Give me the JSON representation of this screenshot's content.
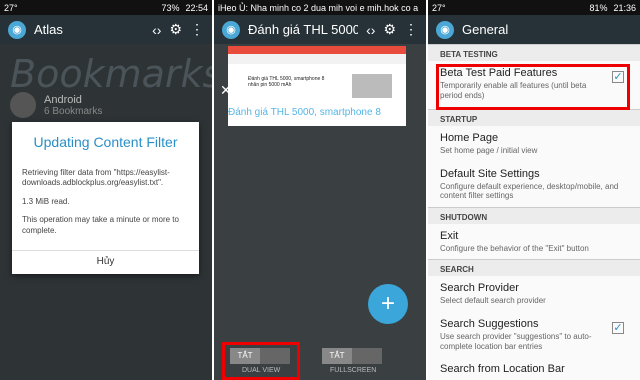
{
  "panel1": {
    "status": {
      "left": "27°",
      "right": "73%",
      "time": "22:54"
    },
    "app_title": "Atlas",
    "bookmarks_heading": "Bookmarks",
    "folder": {
      "name": "Android",
      "count": "6 Bookmarks"
    },
    "dialog": {
      "title": "Updating Content Filter",
      "line1": "Retrieving filter data from \"https://easylist-downloads.adblockplus.org/easylist.txt\".",
      "line2": "1.3 MiB read.",
      "line3": "This operation may take a minute or more to complete.",
      "button": "Hủy"
    }
  },
  "panel2": {
    "status": {
      "notification": "iHeo Ủ: Nha minh co 2 dua mih voi e mih.hok co a"
    },
    "tab_title": "Đánh giá THL 5000",
    "thumb_headline": "Đánh giá THL 5000, smartphone 8 nhân pin 5000 mAh",
    "tab_label": "Đánh giá THL 5000, smartphone 8",
    "fab": "+",
    "toggles": [
      {
        "state": "TẮT",
        "label": "DUAL VIEW"
      },
      {
        "state": "TẮT",
        "label": "FULLSCREEN"
      }
    ]
  },
  "panel3": {
    "status": {
      "left": "27°",
      "right": "81%",
      "time": "21:36"
    },
    "app_title": "General",
    "sections": {
      "beta": "BETA TESTING",
      "startup": "STARTUP",
      "shutdown": "SHUTDOWN",
      "search": "SEARCH"
    },
    "items": {
      "beta_title": "Beta Test Paid Features",
      "beta_desc": "Temporarily enable all features (until beta period ends)",
      "home_title": "Home Page",
      "home_desc": "Set home page / initial view",
      "default_title": "Default Site Settings",
      "default_desc": "Configure default experience, desktop/mobile, and content filter settings",
      "exit_title": "Exit",
      "exit_desc": "Configure the behavior of the \"Exit\" button",
      "provider_title": "Search Provider",
      "provider_desc": "Select default search provider",
      "suggest_title": "Search Suggestions",
      "suggest_desc": "Use search provider \"suggestions\" to auto-complete location bar entries",
      "location_title": "Search from Location Bar"
    }
  },
  "colors": {
    "accent": "#2a8fc7",
    "highlight": "#ee0000",
    "fab": "#3aa6d9"
  }
}
